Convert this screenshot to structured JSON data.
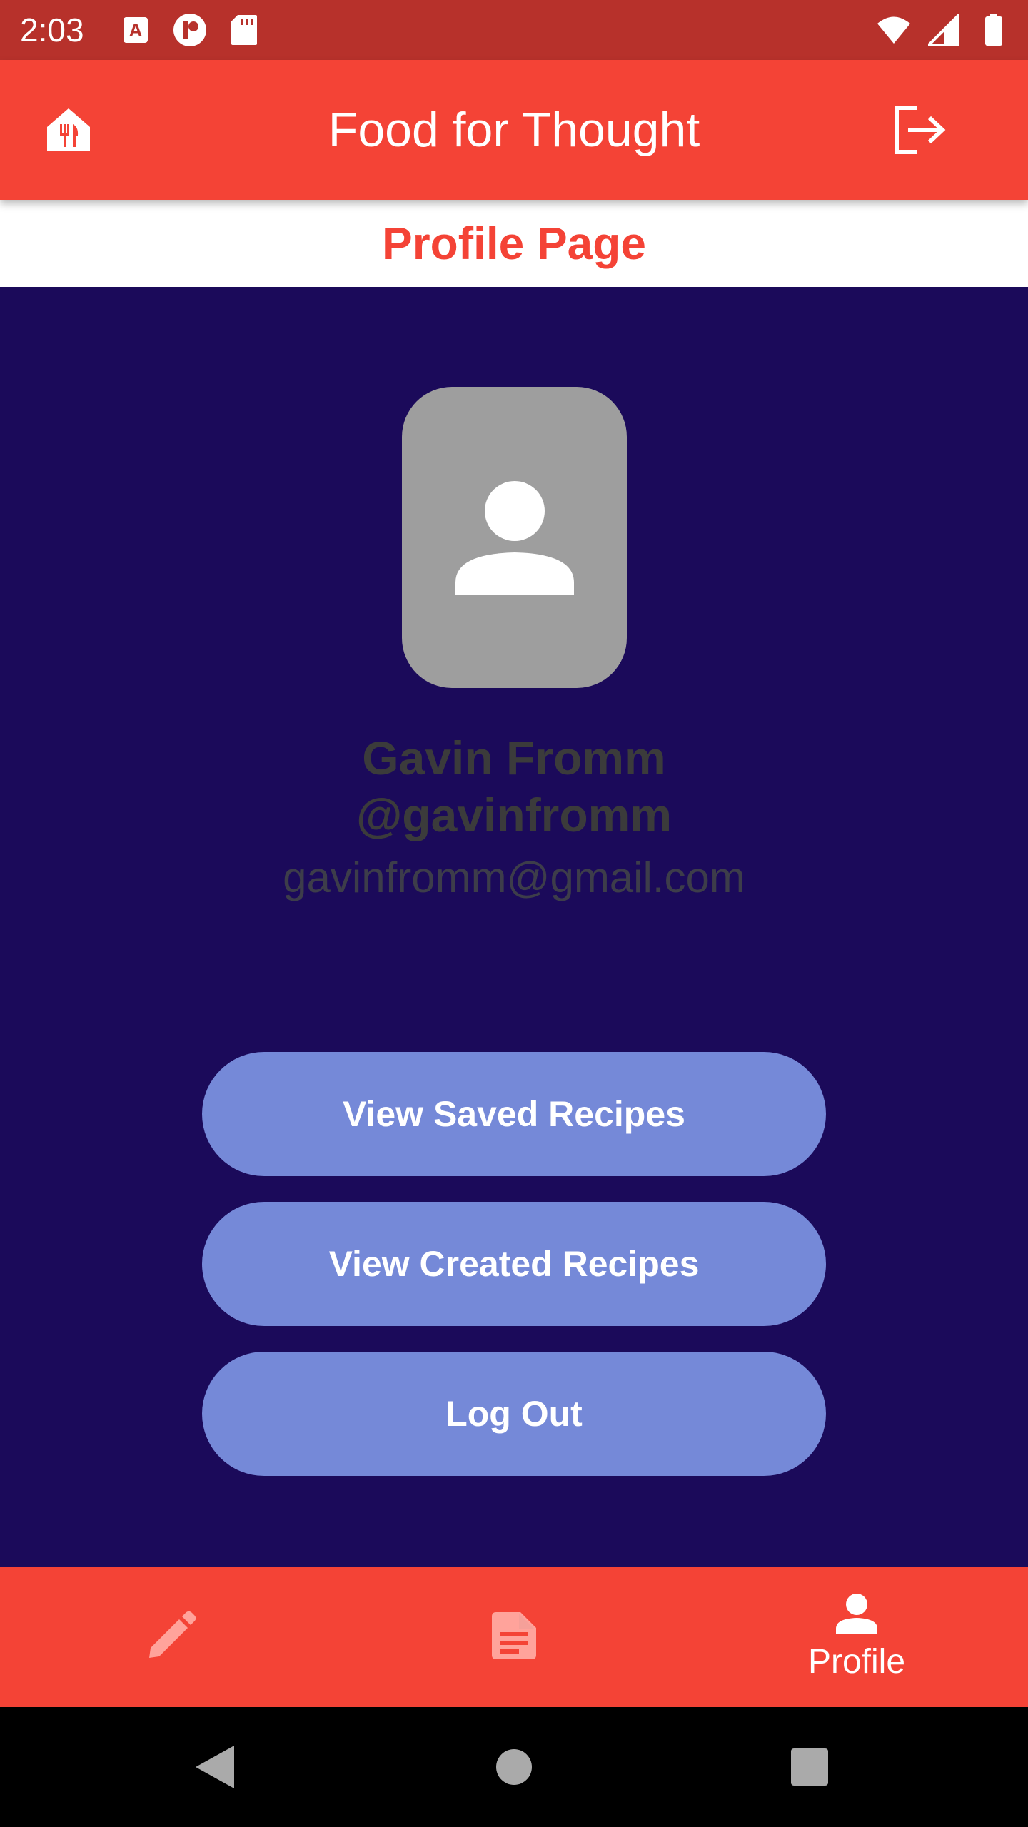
{
  "status_bar": {
    "time": "2:03",
    "left_icons": [
      "a-box-icon",
      "p-circle-icon",
      "sd-card-icon"
    ],
    "right_icons": [
      "wifi-icon",
      "signal-icon",
      "battery-icon"
    ]
  },
  "app_bar": {
    "title": "Food for Thought",
    "left_icon": "restaurant-icon",
    "right_icon": "logout-icon",
    "color": "#f44336"
  },
  "page_header": {
    "title": "Profile Page",
    "color": "#f44336"
  },
  "profile": {
    "avatar_icon": "person-icon",
    "name": "Gavin Fromm",
    "handle": "@gavinfromm",
    "email": "gavinfromm@gmail.com"
  },
  "actions": {
    "view_saved": "View Saved Recipes",
    "view_created": "View Created Recipes",
    "log_out": "Log Out",
    "button_color": "#7589d8"
  },
  "bottom_nav": {
    "items": [
      {
        "icon": "pencil-icon",
        "label": ""
      },
      {
        "icon": "document-icon",
        "label": ""
      },
      {
        "icon": "person-icon",
        "label": "Profile",
        "selected": true
      }
    ]
  },
  "system_nav": {
    "icons": [
      "back-icon",
      "home-icon",
      "recents-icon"
    ]
  },
  "colors": {
    "background": "#1b0a5a",
    "status_bar": "#b7312b"
  }
}
